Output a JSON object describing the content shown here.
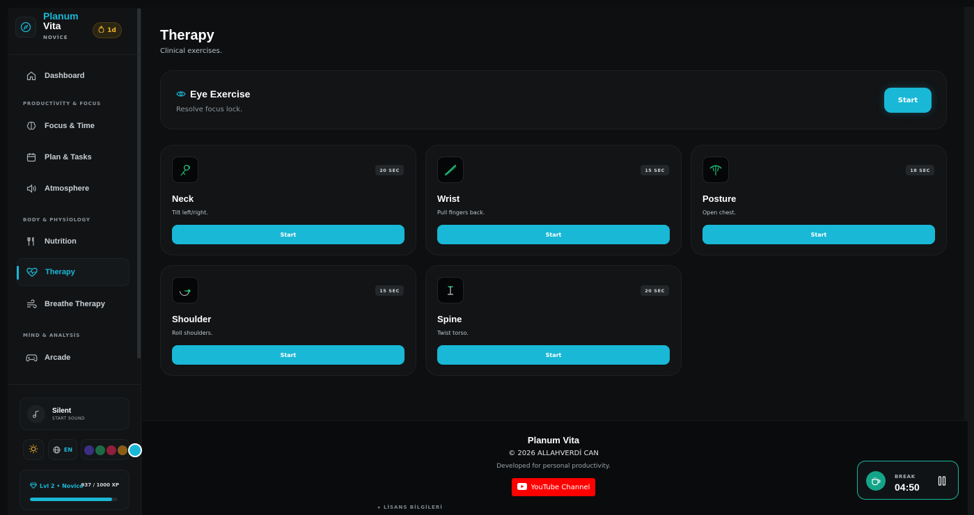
{
  "app": {
    "name_line1": "Planum",
    "name_line2": "Vita",
    "rank": "NOVİCE",
    "streak": "1d"
  },
  "sidebar": {
    "items": [
      {
        "label": "Dashboard"
      },
      {
        "section": "PRODUCTİVİTY & FOCUS"
      },
      {
        "label": "Focus & Time"
      },
      {
        "label": "Plan & Tasks"
      },
      {
        "label": "Atmosphere"
      },
      {
        "section": "BODY & PHYSİOLOGY"
      },
      {
        "label": "Nutrition"
      },
      {
        "label": "Therapy",
        "active": true
      },
      {
        "label": "Breathe Therapy"
      },
      {
        "section": "MİND & ANALYSİS"
      },
      {
        "label": "Arcade"
      }
    ],
    "sound": {
      "title": "Silent",
      "subtitle": "START SOUND"
    },
    "language": "EN",
    "theme_colors": [
      "#3b2f82",
      "#1d6b45",
      "#8f1f3c",
      "#8a5d17",
      "#19b8d6"
    ],
    "xp": {
      "level": "Lvl 2 • Novice",
      "value": "937 / 1000 XP",
      "fraction": 0.937
    }
  },
  "main": {
    "title": "Therapy",
    "subtitle": "Clinical exercises.",
    "hero": {
      "title": "Eye Exercise",
      "subtitle": "Resolve focus lock.",
      "button": "Start"
    },
    "cards": [
      {
        "title": "Neck",
        "desc": "Tilt left/right.",
        "duration": "20 SEC",
        "button": "Start",
        "icon": "neck-icon"
      },
      {
        "title": "Wrist",
        "desc": "Pull fingers back.",
        "duration": "15 SEC",
        "button": "Start",
        "icon": "wrist-icon"
      },
      {
        "title": "Posture",
        "desc": "Open chest.",
        "duration": "18 SEC",
        "button": "Start",
        "icon": "posture-icon"
      },
      {
        "title": "Shoulder",
        "desc": "Roll shoulders.",
        "duration": "15 SEC",
        "button": "Start",
        "icon": "shoulder-icon"
      },
      {
        "title": "Spine",
        "desc": "Twist torso.",
        "duration": "20 SEC",
        "button": "Start",
        "icon": "spine-icon"
      }
    ]
  },
  "footer": {
    "title": "Planum Vita",
    "copyright": "© 2026 ALLAHVERDİ CAN",
    "developed": "Developed for personal productivity.",
    "youtube": "YouTube Channel",
    "license": "▸ LİSANS BİLGİLERİ"
  },
  "timer": {
    "label": "BREAK",
    "value": "04:50"
  },
  "colors": {
    "accent": "#19b8d6",
    "youtube": "#ff0000",
    "timer_border": "#19b8a0"
  }
}
